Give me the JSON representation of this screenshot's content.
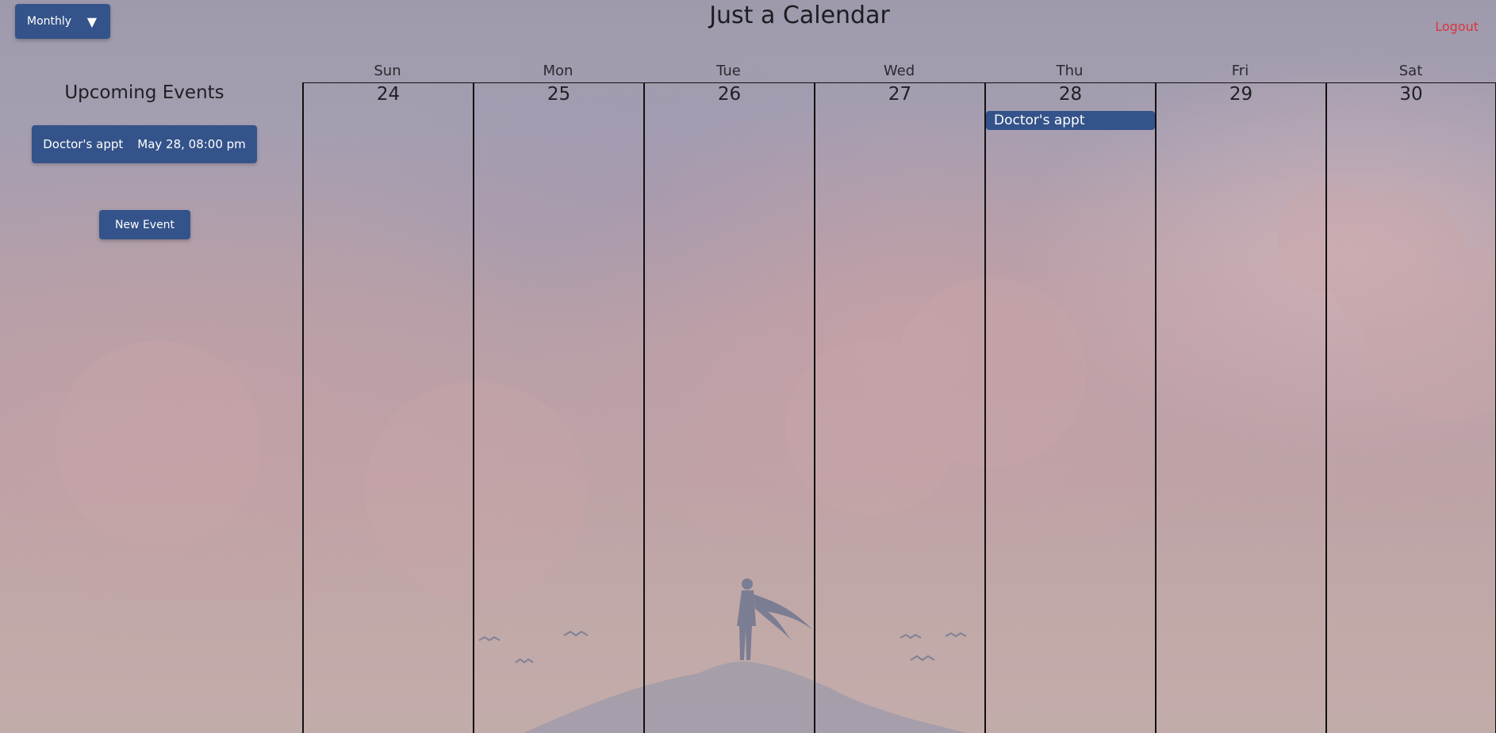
{
  "app": {
    "title": "Just a Calendar",
    "logout_label": "Logout"
  },
  "view_select": {
    "selected": "Monthly",
    "caret": "▼"
  },
  "upcoming": {
    "title": "Upcoming Events",
    "items": [
      {
        "name": "Doctor's appt",
        "when": "May 28, 08:00 pm"
      }
    ],
    "new_event_label": "New Event"
  },
  "calendar": {
    "weekdays": [
      "Sun",
      "Mon",
      "Tue",
      "Wed",
      "Thu",
      "Fri",
      "Sat"
    ],
    "days": [
      {
        "date": "24",
        "events": []
      },
      {
        "date": "25",
        "events": []
      },
      {
        "date": "26",
        "events": []
      },
      {
        "date": "27",
        "events": []
      },
      {
        "date": "28",
        "events": [
          "Doctor's appt"
        ]
      },
      {
        "date": "29",
        "events": []
      },
      {
        "date": "30",
        "events": []
      }
    ]
  },
  "colors": {
    "accent": "#34538a",
    "logout": "#d8363d"
  }
}
